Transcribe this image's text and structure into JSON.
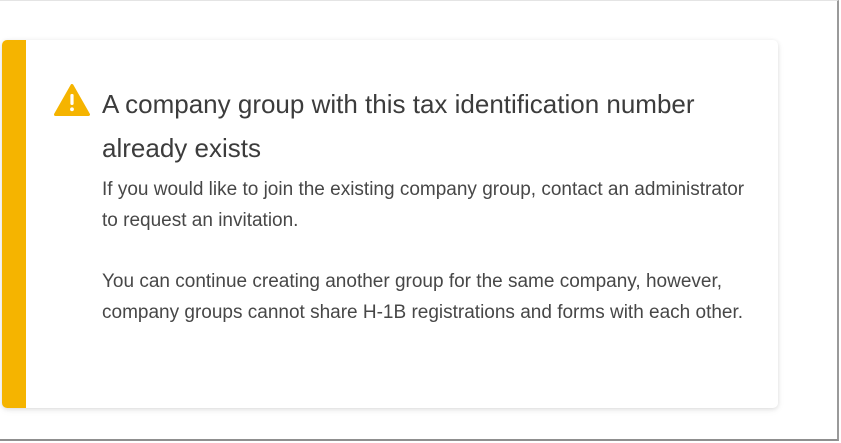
{
  "colors": {
    "accent": "#f5b400",
    "icon": "#f5b400"
  },
  "alert": {
    "icon": "warning-triangle-icon",
    "title": "A company group with this tax identification number already exists",
    "message_1": "If you would like to join the existing company group, contact an administrator to request an invitation.",
    "message_2": "You can continue creating another group for the same company, however, company groups cannot share H-1B registrations and forms with each other."
  }
}
